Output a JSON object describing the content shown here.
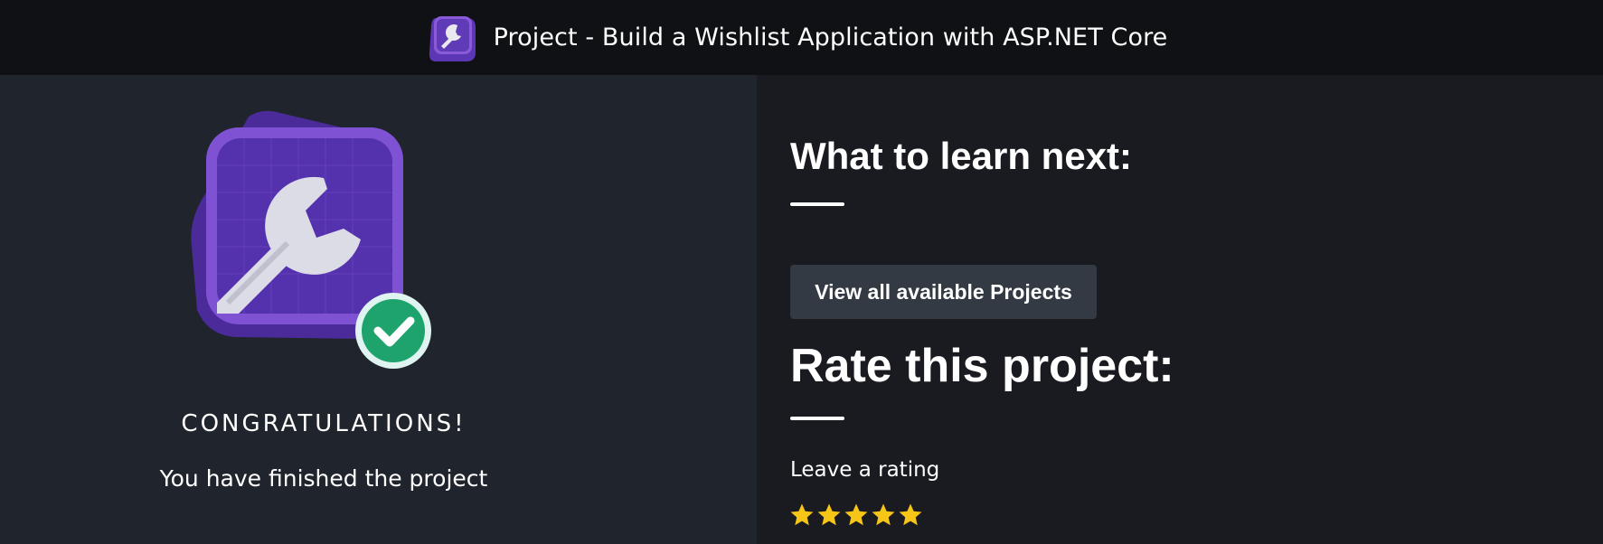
{
  "header": {
    "title": "Project - Build a Wishlist Application with ASP.NET Core",
    "icon": "wrench-icon"
  },
  "completion": {
    "heading": "CONGRATULATIONS!",
    "message": "You have finished the project",
    "badge_icon": "wrench-icon",
    "check_icon": "checkmark-icon"
  },
  "next": {
    "heading": "What to learn next:",
    "button_label": "View all available Projects"
  },
  "rating": {
    "heading": "Rate this project:",
    "prompt": "Leave a rating",
    "max_stars": 5,
    "filled_stars": 5
  },
  "colors": {
    "accent_purple": "#7a4fd0",
    "star_gold": "#f5c518",
    "check_green": "#1fa35f"
  }
}
